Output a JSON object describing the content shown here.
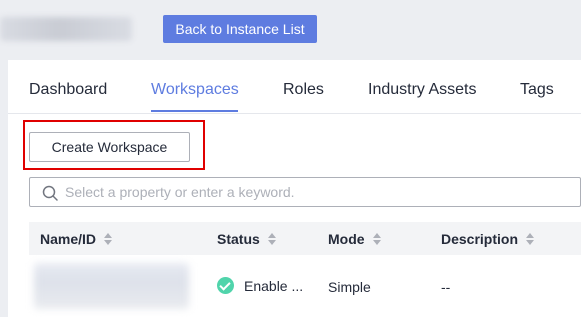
{
  "header": {
    "back_button_label": "Back to Instance List"
  },
  "tabs": [
    {
      "label": "Dashboard",
      "active": false
    },
    {
      "label": "Workspaces",
      "active": true
    },
    {
      "label": "Roles",
      "active": false
    },
    {
      "label": "Industry Assets",
      "active": false
    },
    {
      "label": "Tags",
      "active": false
    }
  ],
  "toolbar": {
    "create_label": "Create Workspace"
  },
  "search": {
    "placeholder": "Select a property or enter a keyword.",
    "value": ""
  },
  "table": {
    "columns": [
      "Name/ID",
      "Status",
      "Mode",
      "Description"
    ],
    "rows": [
      {
        "status": "Enable ...",
        "mode": "Simple",
        "description": "--"
      }
    ]
  },
  "colors": {
    "accent": "#5e7ce0",
    "highlight": "#e00000",
    "status_enabled": "#50d4ab"
  }
}
